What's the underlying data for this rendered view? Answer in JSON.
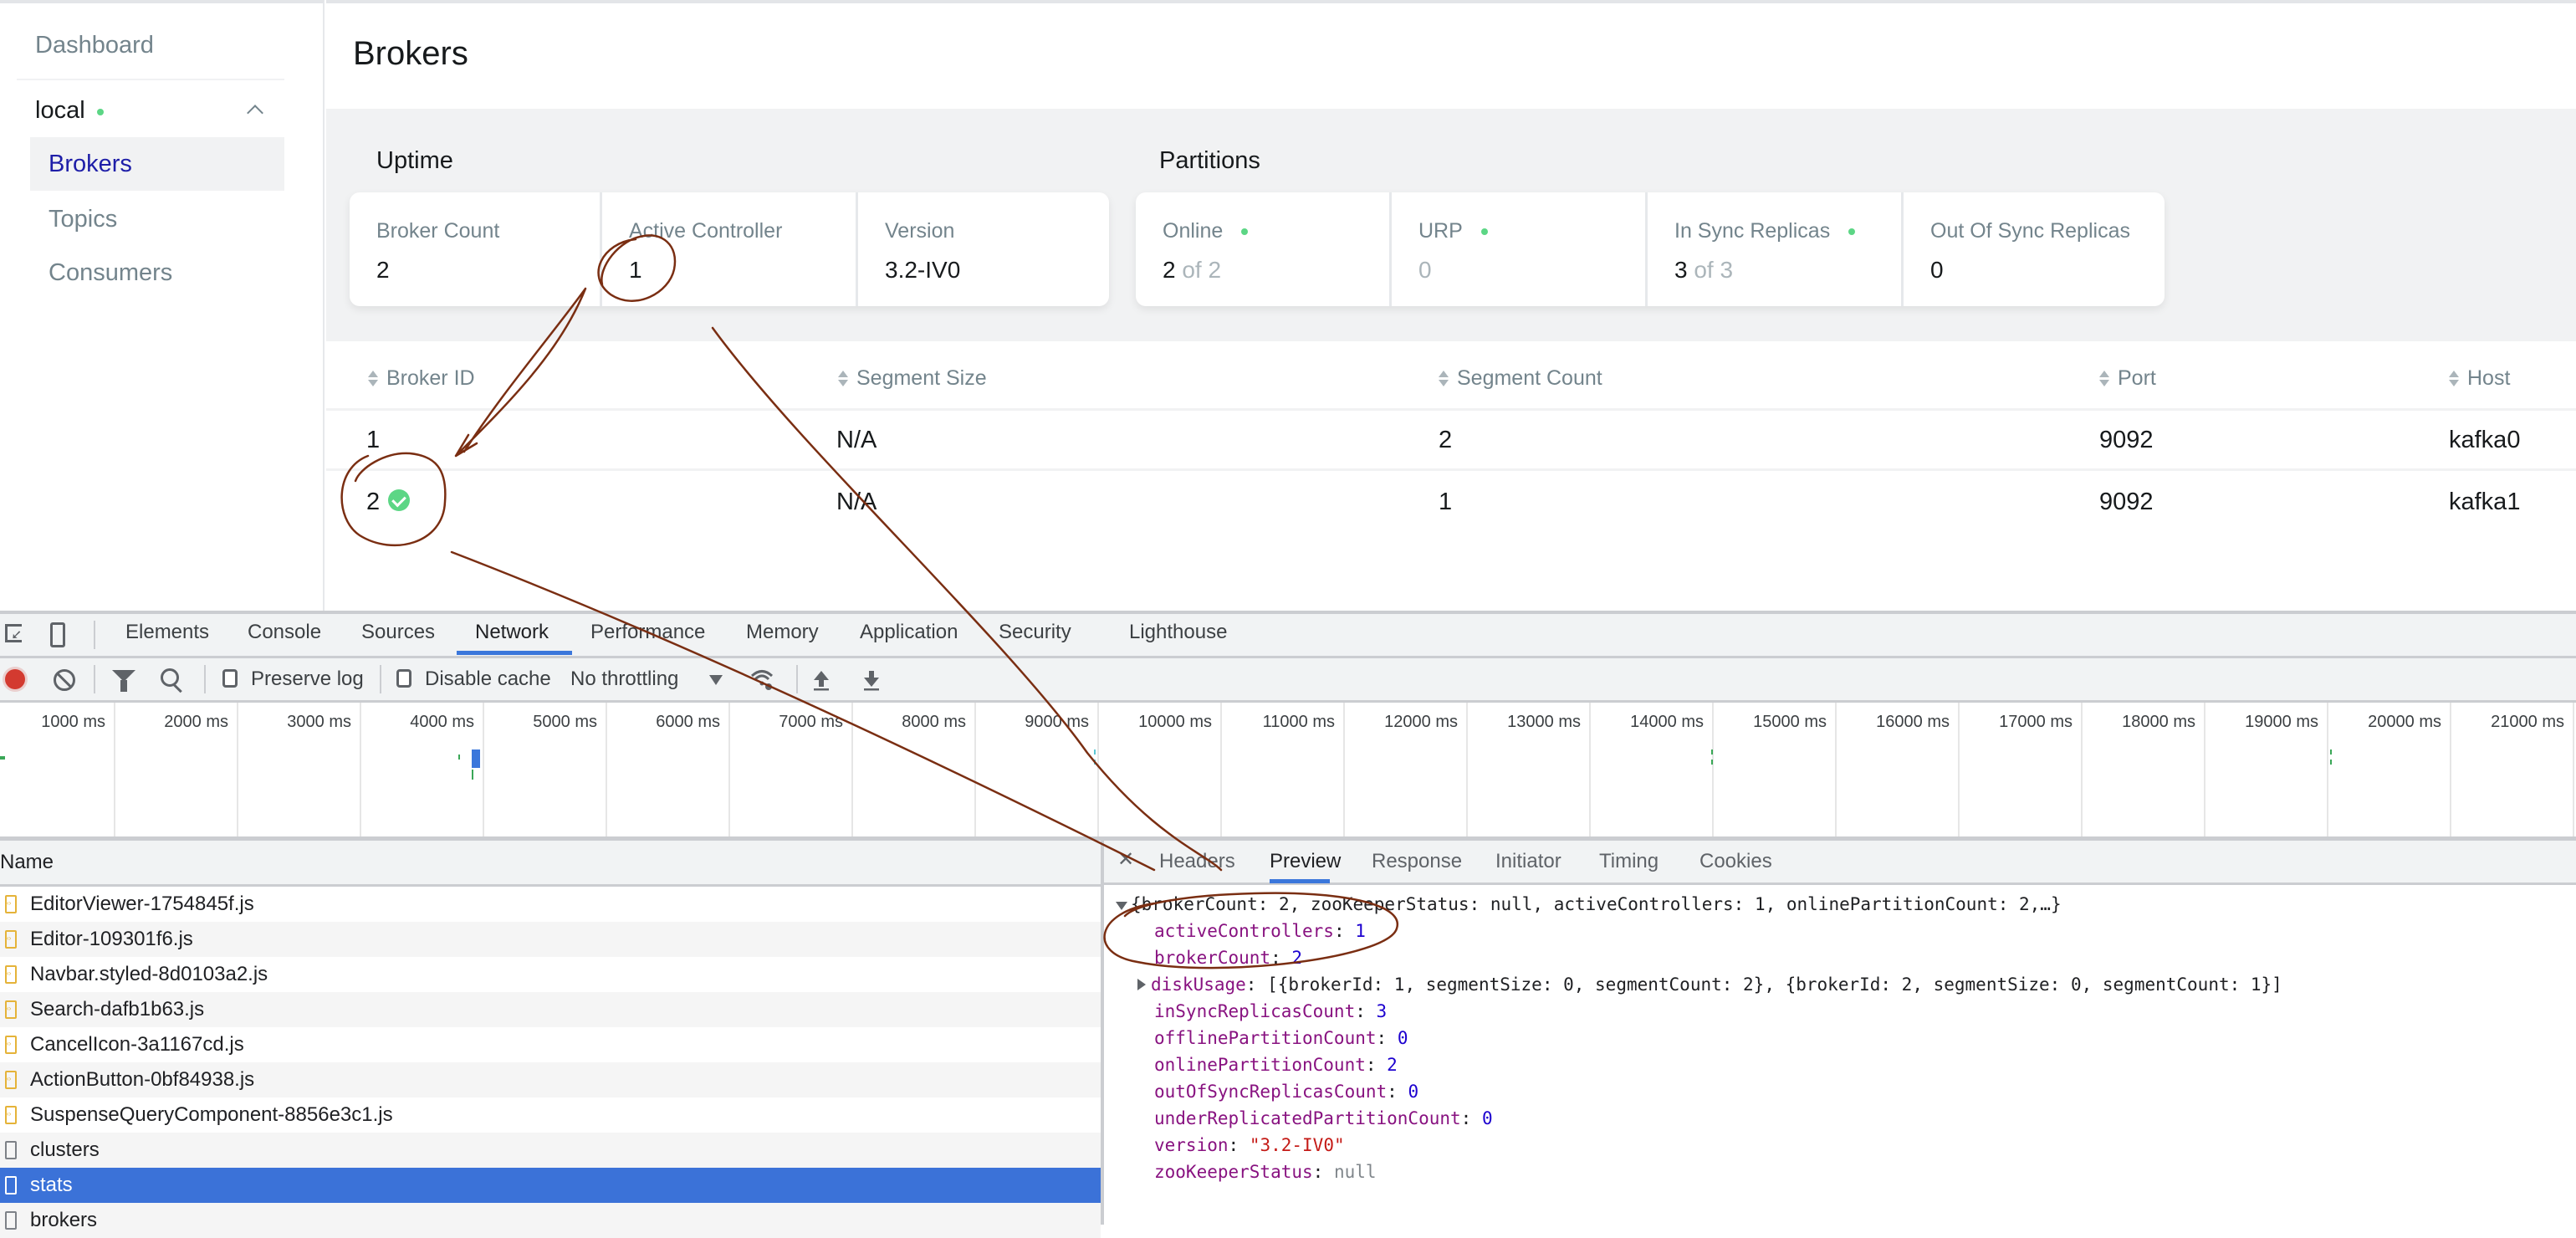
{
  "sidebar": {
    "dashboard": "Dashboard",
    "cluster": {
      "name": "local",
      "status_color": "#5cd685"
    },
    "items": [
      {
        "label": "Brokers",
        "active": true
      },
      {
        "label": "Topics",
        "active": false
      },
      {
        "label": "Consumers",
        "active": false
      }
    ]
  },
  "page": {
    "title": "Brokers"
  },
  "uptime": {
    "title": "Uptime",
    "metrics": [
      {
        "label": "Broker Count",
        "value": "2"
      },
      {
        "label": "Active Controller",
        "value": "1"
      },
      {
        "label": "Version",
        "value": "3.2-IV0"
      }
    ]
  },
  "partitions": {
    "title": "Partitions",
    "metrics": [
      {
        "label": "Online",
        "value": "2",
        "suffix": "of 2",
        "dot": true
      },
      {
        "label": "URP",
        "value": "0",
        "dot": true
      },
      {
        "label": "In Sync Replicas",
        "value": "3",
        "suffix": "of 3",
        "dot": true
      },
      {
        "label": "Out Of Sync Replicas",
        "value": "0",
        "dot": false
      }
    ]
  },
  "table": {
    "columns": [
      "Broker ID",
      "Segment Size",
      "Segment Count",
      "Port",
      "Host"
    ],
    "rows": [
      {
        "broker_id": "1",
        "segment_size": "N/A",
        "segment_count": "2",
        "port": "9092",
        "host": "kafka0",
        "controller": false
      },
      {
        "broker_id": "2",
        "segment_size": "N/A",
        "segment_count": "1",
        "port": "9092",
        "host": "kafka1",
        "controller": true
      }
    ]
  },
  "devtools": {
    "tabs": [
      "Elements",
      "Console",
      "Sources",
      "Network",
      "Performance",
      "Memory",
      "Application",
      "Security",
      "Lighthouse"
    ],
    "active_tab": "Network",
    "toolbar": {
      "preserve_log": "Preserve log",
      "disable_cache": "Disable cache",
      "throttling": "No throttling"
    },
    "timeline_ticks": [
      "1000 ms",
      "2000 ms",
      "3000 ms",
      "4000 ms",
      "5000 ms",
      "6000 ms",
      "7000 ms",
      "8000 ms",
      "9000 ms",
      "10000 ms",
      "11000 ms",
      "12000 ms",
      "13000 ms",
      "14000 ms",
      "15000 ms",
      "16000 ms",
      "17000 ms",
      "18000 ms",
      "19000 ms",
      "20000 ms",
      "21000 ms"
    ],
    "requests_header": "Name",
    "requests": [
      {
        "name": "EditorViewer-1754845f.js",
        "type": "js"
      },
      {
        "name": "Editor-109301f6.js",
        "type": "js"
      },
      {
        "name": "Navbar.styled-8d0103a2.js",
        "type": "js"
      },
      {
        "name": "Search-dafb1b63.js",
        "type": "js"
      },
      {
        "name": "CancelIcon-3a1167cd.js",
        "type": "js"
      },
      {
        "name": "ActionButton-0bf84938.js",
        "type": "js"
      },
      {
        "name": "SuspenseQueryComponent-8856e3c1.js",
        "type": "js"
      },
      {
        "name": "clusters",
        "type": "doc"
      },
      {
        "name": "stats",
        "type": "doc",
        "selected": true
      },
      {
        "name": "brokers",
        "type": "doc"
      }
    ],
    "detail_tabs": [
      "Headers",
      "Preview",
      "Response",
      "Initiator",
      "Timing",
      "Cookies"
    ],
    "active_detail_tab": "Preview",
    "preview": {
      "summary": "{brokerCount: 2, zooKeeperStatus: null, activeControllers: 1, onlinePartitionCount: 2,…}",
      "fields": [
        {
          "key": "activeControllers",
          "value": "1",
          "kind": "num"
        },
        {
          "key": "brokerCount",
          "value": "2",
          "kind": "num"
        },
        {
          "key": "diskUsage",
          "value": "[{brokerId: 1, segmentSize: 0, segmentCount: 2}, {brokerId: 2, segmentSize: 0, segmentCount: 1}]",
          "kind": "obj",
          "expandable": true
        },
        {
          "key": "inSyncReplicasCount",
          "value": "3",
          "kind": "num"
        },
        {
          "key": "offlinePartitionCount",
          "value": "0",
          "kind": "num"
        },
        {
          "key": "onlinePartitionCount",
          "value": "2",
          "kind": "num"
        },
        {
          "key": "outOfSyncReplicasCount",
          "value": "0",
          "kind": "num"
        },
        {
          "key": "underReplicatedPartitionCount",
          "value": "0",
          "kind": "num"
        },
        {
          "key": "version",
          "value": "\"3.2-IV0\"",
          "kind": "str"
        },
        {
          "key": "zooKeeperStatus",
          "value": "null",
          "kind": "null"
        }
      ]
    }
  },
  "colors": {
    "accent": "#1e1ea8",
    "status_green": "#5cd685",
    "devtools_blue": "#3b77db",
    "annotation": "#7a2e12"
  }
}
